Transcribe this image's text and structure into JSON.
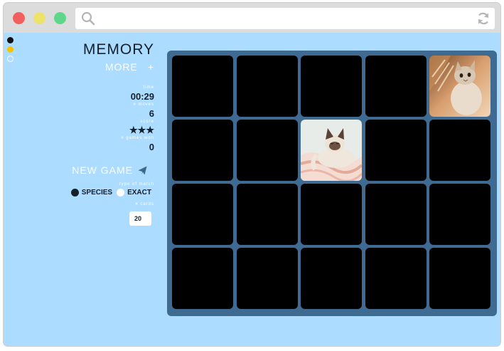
{
  "app": {
    "title": "MEMORY",
    "more_label": "MORE",
    "more_plus": "+",
    "stats": {
      "time_label": "time",
      "time_value": "00:29",
      "moves_label": "# moves",
      "moves_value": "6",
      "score_label": "score",
      "score_value": "★★★",
      "games_won_label": "# games won",
      "games_won_value": "0"
    },
    "new_game_label": "NEW GAME",
    "match_type": {
      "label": "type of match",
      "options": [
        "SPECIES",
        "EXACT"
      ],
      "selected": "SPECIES"
    },
    "cards": {
      "label": "# cards",
      "value": "20"
    },
    "theme_colors": [
      "#111111",
      "#f5c400",
      "#acdcff"
    ],
    "board": {
      "rows": 4,
      "cols": 5,
      "face_up": [
        {
          "row": 0,
          "col": 4,
          "image": "kitten-by-window"
        },
        {
          "row": 1,
          "col": 2,
          "image": "siamese-kitten-on-blanket"
        }
      ]
    }
  },
  "icons": {
    "search": "search-icon",
    "refresh": "refresh-icon",
    "send": "paper-plane-icon"
  }
}
